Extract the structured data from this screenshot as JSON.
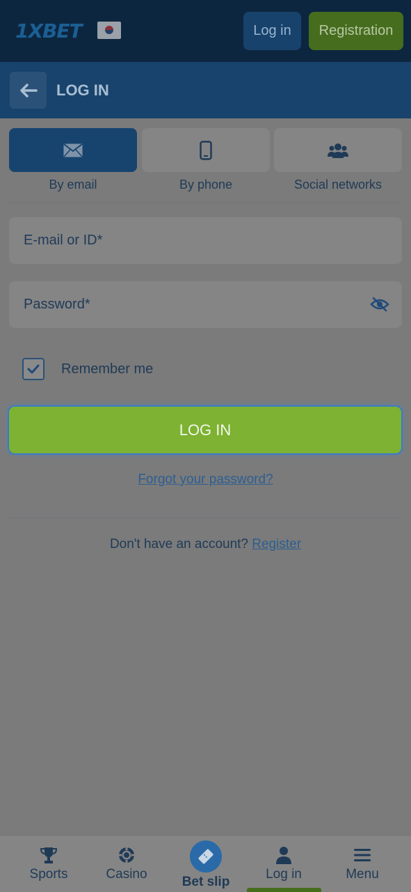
{
  "topbar": {
    "logo": "1XBET",
    "login_label": "Log in",
    "registration_label": "Registration"
  },
  "header": {
    "title": "LOG IN"
  },
  "tabs": [
    {
      "label": "By email",
      "icon": "envelope-icon",
      "active": true
    },
    {
      "label": "By phone",
      "icon": "phone-icon",
      "active": false
    },
    {
      "label": "Social networks",
      "icon": "users-icon",
      "active": false
    }
  ],
  "form": {
    "email_placeholder": "E-mail or ID*",
    "password_placeholder": "Password*",
    "remember_label": "Remember me",
    "remember_checked": true,
    "submit_label": "LOG IN",
    "forgot_label": "Forgot your password?",
    "no_account_text": "Don't have an account?",
    "register_link": "Register"
  },
  "bottom_nav": [
    {
      "label": "Sports",
      "icon": "trophy-icon"
    },
    {
      "label": "Casino",
      "icon": "casino-chip-icon"
    },
    {
      "label": "Bet slip",
      "icon": "ticket-icon"
    },
    {
      "label": "Log in",
      "icon": "user-icon"
    },
    {
      "label": "Menu",
      "icon": "hamburger-icon"
    }
  ],
  "colors": {
    "primary_blue": "#18436c",
    "accent_green": "#7db232",
    "link_blue": "#2c5e91"
  }
}
